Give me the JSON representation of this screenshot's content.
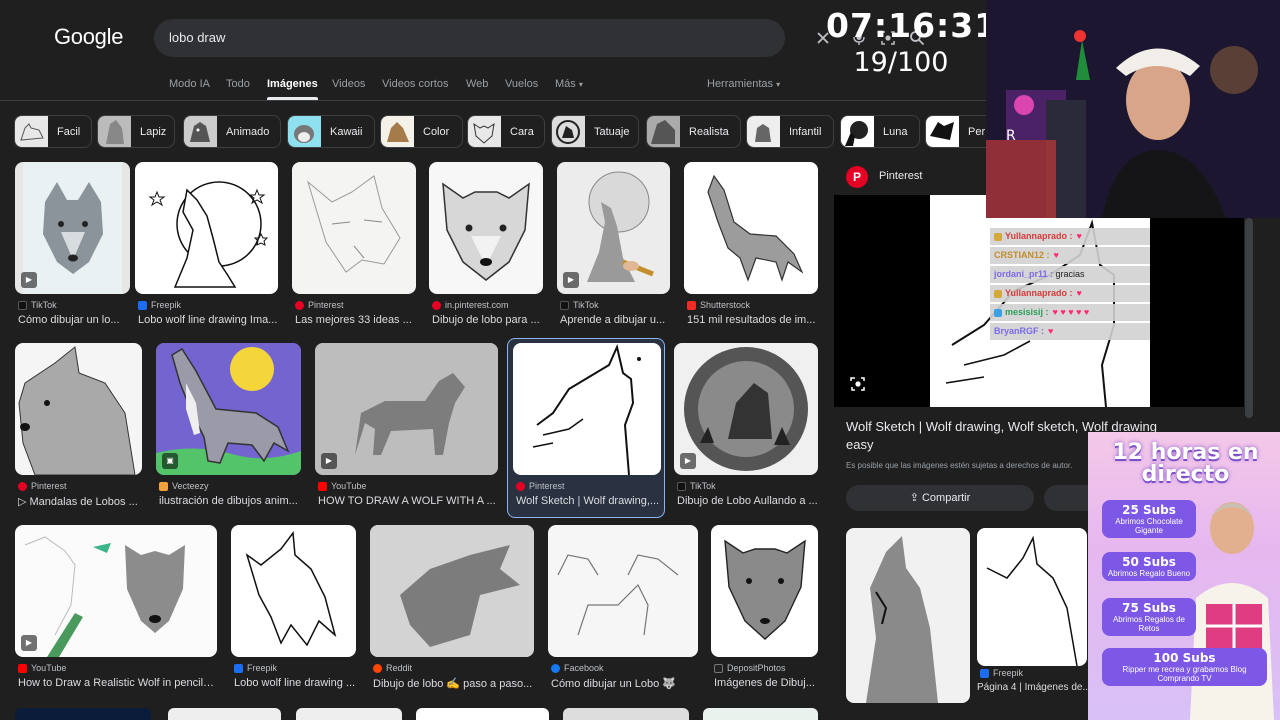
{
  "google_logo": "Google",
  "search": {
    "query": "lobo draw"
  },
  "tabs": [
    {
      "label": "Modo IA"
    },
    {
      "label": "Todo"
    },
    {
      "label": "Imágenes"
    },
    {
      "label": "Videos"
    },
    {
      "label": "Videos cortos"
    },
    {
      "label": "Web"
    },
    {
      "label": "Vuelos"
    },
    {
      "label": "Más"
    },
    {
      "label": "Herramientas"
    }
  ],
  "chips": [
    {
      "label": "Facil"
    },
    {
      "label": "Lapiz"
    },
    {
      "label": "Animado"
    },
    {
      "label": "Kawaii"
    },
    {
      "label": "Color"
    },
    {
      "label": "Cara"
    },
    {
      "label": "Tatuaje"
    },
    {
      "label": "Realista"
    },
    {
      "label": "Infantil"
    },
    {
      "label": "Luna"
    },
    {
      "label": "Per"
    }
  ],
  "results": [
    {
      "source": "TikTok",
      "title": "Cómo dibujar un lo..."
    },
    {
      "source": "Freepik",
      "title": "Lobo wolf line drawing Ima..."
    },
    {
      "source": "Pinterest",
      "title": "Las mejores 33 ideas ..."
    },
    {
      "source": "in.pinterest.com",
      "title": "Dibujo de lobo para ..."
    },
    {
      "source": "TikTok",
      "title": "Aprende a dibujar u..."
    },
    {
      "source": "Shutterstock",
      "title": "151 mil resultados de im..."
    },
    {
      "source": "Pinterest",
      "title": "▷ Mandalas de Lobos ..."
    },
    {
      "source": "Vecteezy",
      "title": "ilustración de dibujos anim..."
    },
    {
      "source": "YouTube",
      "title": "HOW TO DRAW A WOLF WITH A ..."
    },
    {
      "source": "Pinterest",
      "title": "Wolf Sketch | Wolf drawing,..."
    },
    {
      "source": "TikTok",
      "title": "Dibujo de Lobo Aullando a ..."
    },
    {
      "source": "YouTube",
      "title": "How to Draw a Realistic Wolf in pencil -..."
    },
    {
      "source": "Freepik",
      "title": "Lobo wolf line drawing ..."
    },
    {
      "source": "Reddit",
      "title": "Dibujo de lobo ✍️ paso a paso..."
    },
    {
      "source": "Facebook",
      "title": "Cómo dibujar un Lobo 🐺"
    },
    {
      "source": "DepositPhotos",
      "title": "Imágenes de Dibuj..."
    }
  ],
  "panel": {
    "source": "Pinterest",
    "title": "Wolf Sketch | Wolf drawing, Wolf sketch, Wolf drawing easy",
    "note": "Es posible que las imágenes estén sujetas a derechos de autor.",
    "share_label": "Compartir",
    "related": [
      {
        "source": "Freepik",
        "title": "Página 4 | Imágenes de..."
      }
    ]
  },
  "overlay": {
    "timer": "07:16:31",
    "counter": "19/100",
    "chat": [
      {
        "user": "Yullannaprado :"
      },
      {
        "user": "CRSTIAN12 :"
      },
      {
        "user": "jordani_pr11 :",
        "message": "gracias"
      },
      {
        "user": "Yullannaprado :"
      },
      {
        "user": "mesisisij :"
      },
      {
        "user": "BryanRGF :"
      }
    ],
    "promo": {
      "headline": "12 horas en directo",
      "goals": [
        {
          "amount": "25 Subs",
          "reward": "Abrimos Chocolate Gigante"
        },
        {
          "amount": "50 Subs",
          "reward": "Abrimos Regalo Bueno"
        },
        {
          "amount": "75 Subs",
          "reward": "Abrimos Regalos de Retos"
        },
        {
          "amount": "100 Subs",
          "reward": "Ripper me recrea y grabamos Blog Comprando TV"
        }
      ]
    }
  },
  "colors": {
    "background": "#1f1f1f",
    "searchbar": "#303134",
    "accent": "#8ab4f8",
    "pinterest": "#e60023"
  }
}
